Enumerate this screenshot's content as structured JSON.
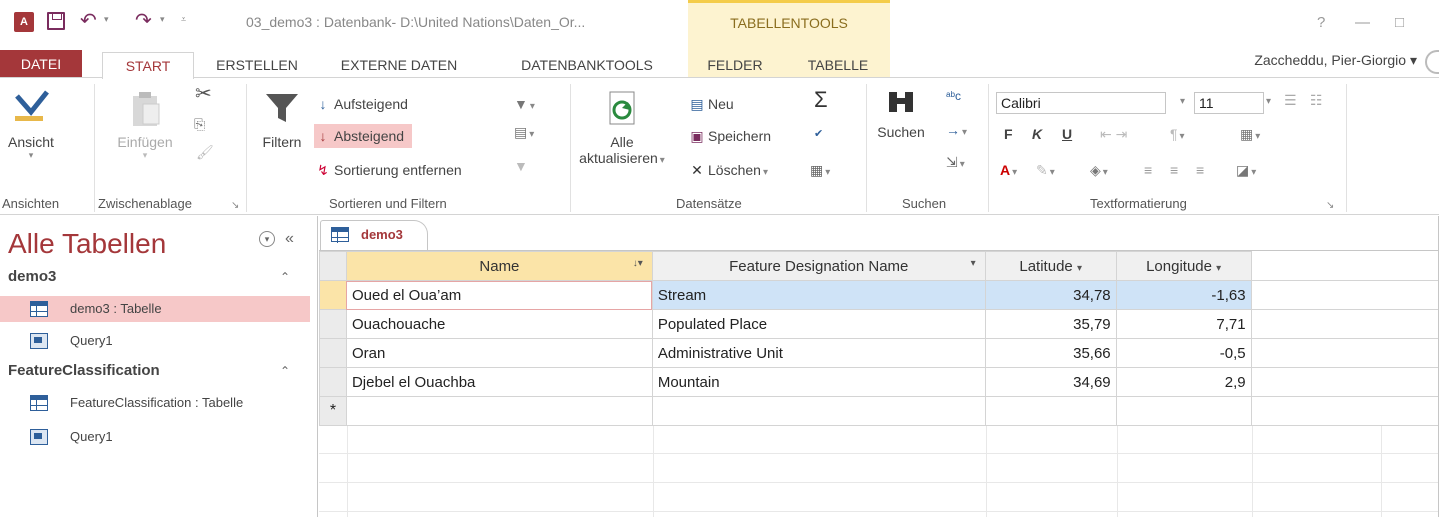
{
  "titlebar": {
    "app_icon": "A⃣",
    "window_title": "03_demo3 : Datenbank- D:\\United Nations\\Daten_Or...",
    "context_title": "TABELLENTOOLS",
    "help": "?",
    "minimize": "—",
    "restore": "□"
  },
  "tabs": {
    "datei": "DATEI",
    "start": "START",
    "erstellen": "ERSTELLEN",
    "externe": "EXTERNE DATEN",
    "dbtools": "DATENBANKTOOLS",
    "felder": "FELDER",
    "tabelle": "TABELLE"
  },
  "user": {
    "name": "Zaccheddu, Pier-Giorgio ▾"
  },
  "ribbon": {
    "ansicht": {
      "label": "Ansicht",
      "group": "Ansichten"
    },
    "zwischenablage": {
      "paste_label": "Einfügen",
      "group": "Zwischenablage"
    },
    "sortieren": {
      "filter_label": "Filtern",
      "asc": "Aufsteigend",
      "desc": "Absteigend",
      "remove": "Sortierung entfernen",
      "group": "Sortieren und Filtern"
    },
    "datensaetze": {
      "refresh_line1": "Alle",
      "refresh_line2": "aktualisieren",
      "new": "Neu",
      "save": "Speichern",
      "delete": "Löschen",
      "group": "Datensätze"
    },
    "suchen": {
      "search_label": "Suchen",
      "group": "Suchen"
    },
    "text": {
      "font": "Calibri",
      "size": "11",
      "bold": "F",
      "italic": "K",
      "underline": "U",
      "group": "Textformatierung"
    }
  },
  "nav": {
    "title": "Alle Tabellen",
    "groups": [
      {
        "name": "demo3",
        "items": [
          {
            "label": "demo3 : Tabelle",
            "type": "table"
          },
          {
            "label": "Query1",
            "type": "query"
          }
        ]
      },
      {
        "name": "FeatureClassification",
        "items": [
          {
            "label": "FeatureClassification : Tabelle",
            "type": "table"
          },
          {
            "label": "Query1",
            "type": "query"
          }
        ]
      }
    ]
  },
  "document": {
    "tab_label": "demo3",
    "columns": [
      "Name",
      "Feature Designation Name",
      "Latitude",
      "Longitude"
    ],
    "rows": [
      {
        "name": "Oued el Oua’am",
        "feature": "Stream",
        "lat": "34,78",
        "lon": "-1,63"
      },
      {
        "name": "Ouachouache",
        "feature": "Populated Place",
        "lat": "35,79",
        "lon": "7,71"
      },
      {
        "name": "Oran",
        "feature": "Administrative Unit",
        "lat": "35,66",
        "lon": "-0,5"
      },
      {
        "name": "Djebel el Ouachba",
        "feature": "Mountain",
        "lat": "34,69",
        "lon": "2,9"
      }
    ],
    "new_row_marker": "*"
  }
}
